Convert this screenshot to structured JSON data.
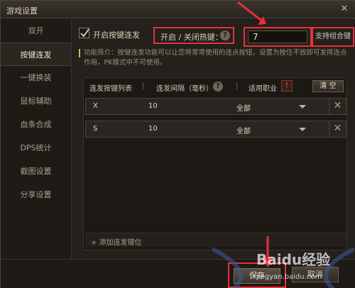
{
  "window": {
    "title": "游戏设置",
    "close_glyph": "✕"
  },
  "sidebar": {
    "items": [
      {
        "label": "双开"
      },
      {
        "label": "按键连发"
      },
      {
        "label": "一键换装"
      },
      {
        "label": "鼠标辅助"
      },
      {
        "label": "血条合成"
      },
      {
        "label": "DPS统计"
      },
      {
        "label": "截图设置"
      },
      {
        "label": "分享设置"
      }
    ],
    "active_index": 1
  },
  "top": {
    "enable_label": "开启按键连发",
    "enable_checked": true,
    "hotkey_label": "开启 / 关闭热键：",
    "hotkey_value": "7",
    "combo_label": "支持组合键"
  },
  "description": {
    "text": "功能简介：按键连发功能可以让您将常常使用的连点按钮，设置为按住不放即可发挥连点作用，PK模式中不可使用。"
  },
  "table": {
    "col_list": "连发按键列表",
    "col_interval": "连发间隔（毫秒）",
    "col_job": "适用职业",
    "sep": "|",
    "info_glyph": "!",
    "clear_label": "清 空",
    "rows": [
      {
        "key": "X",
        "interval": "10",
        "job": "全部"
      },
      {
        "key": "S",
        "interval": "10",
        "job": "全部"
      }
    ],
    "add_label": "+ 添加连发键位"
  },
  "footer": {
    "save_label": "保存",
    "cancel_label": "取消"
  },
  "help_glyph": "?",
  "delete_glyph": "✕",
  "watermark": {
    "brand": "Baidu经验",
    "url": "jingyan.baidu.com"
  },
  "colors": {
    "highlight": "#e8303a",
    "info": "#e85a3a"
  }
}
